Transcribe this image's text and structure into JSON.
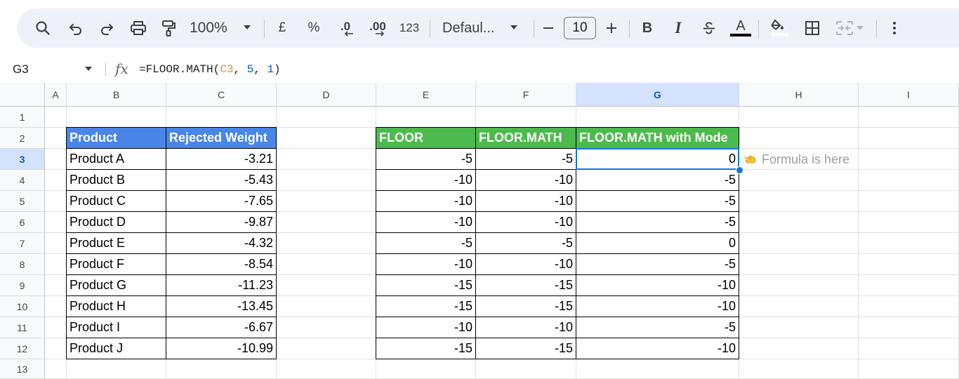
{
  "toolbar": {
    "zoom": "100%",
    "currency": "£",
    "percent": "%",
    "decrease_decimal": ".0",
    "increase_decimal": ".00",
    "number_format": "123",
    "font": "Defaul...",
    "font_size": "10",
    "bold": "B",
    "italic": "I",
    "text_color_letter": "A"
  },
  "formula_bar": {
    "cell_ref": "G3",
    "fx": "fx",
    "formula_prefix": "=FLOOR.MATH(",
    "formula_ref": "C3",
    "formula_sep1": ", ",
    "formula_arg2": "5",
    "formula_sep2": ", ",
    "formula_arg3": "1",
    "formula_suffix": ")"
  },
  "columns": [
    "A",
    "B",
    "C",
    "D",
    "E",
    "F",
    "G",
    "H",
    "I"
  ],
  "rows": [
    "1",
    "2",
    "3",
    "4",
    "5",
    "6",
    "7",
    "8",
    "9",
    "10",
    "11",
    "12",
    "13"
  ],
  "selected_cell": "G3",
  "left_table": {
    "headers": [
      "Product",
      "Rejected Weight"
    ],
    "rows": [
      [
        "Product A",
        "-3.21"
      ],
      [
        "Product B",
        "-5.43"
      ],
      [
        "Product C",
        "-7.65"
      ],
      [
        "Product D",
        "-9.87"
      ],
      [
        "Product E",
        "-4.32"
      ],
      [
        "Product F",
        "-8.54"
      ],
      [
        "Product G",
        "-11.23"
      ],
      [
        "Product H",
        "-13.45"
      ],
      [
        "Product I",
        "-6.67"
      ],
      [
        "Product J",
        "-10.99"
      ]
    ]
  },
  "right_table": {
    "headers": [
      "FLOOR",
      "FLOOR.MATH",
      "FLOOR.MATH with Mode"
    ],
    "rows": [
      [
        "-5",
        "-5",
        "0"
      ],
      [
        "-10",
        "-10",
        "-5"
      ],
      [
        "-10",
        "-10",
        "-5"
      ],
      [
        "-10",
        "-10",
        "-5"
      ],
      [
        "-5",
        "-5",
        "0"
      ],
      [
        "-10",
        "-10",
        "-5"
      ],
      [
        "-15",
        "-15",
        "-10"
      ],
      [
        "-15",
        "-15",
        "-10"
      ],
      [
        "-10",
        "-10",
        "-5"
      ],
      [
        "-15",
        "-15",
        "-10"
      ]
    ]
  },
  "annotation": {
    "text": "Formula is here",
    "icon": "pointing-hand-icon"
  },
  "colors": {
    "header_blue": "#4a86e8",
    "header_green": "#4cba4c",
    "selection": "#1a73e8",
    "formula_ref": "#e69138",
    "formula_number": "#1155cc"
  }
}
